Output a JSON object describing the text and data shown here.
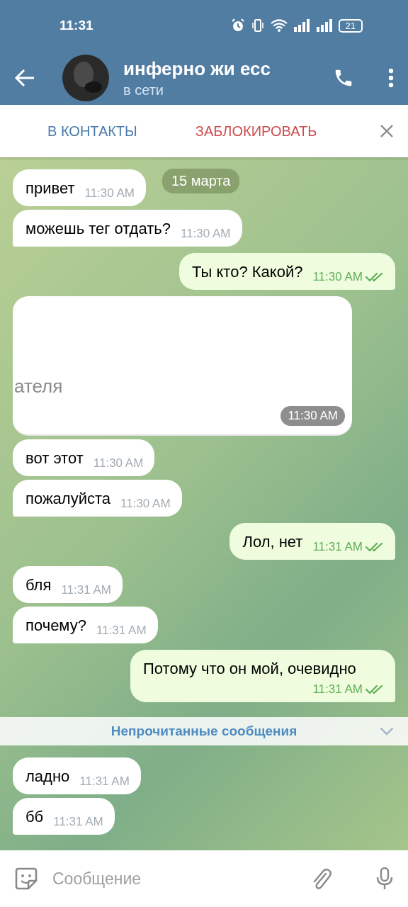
{
  "status_bar": {
    "time": "11:31",
    "battery": "21"
  },
  "header": {
    "title": "инферно жи есс",
    "status": "в сети"
  },
  "action_bar": {
    "add_contact": "В КОНТАКТЫ",
    "block": "ЗАБЛОКИРОВАТЬ"
  },
  "date_chip": "15 марта",
  "messages": [
    {
      "kind": "incoming",
      "text": "привет",
      "time": "11:30 AM",
      "tail": false
    },
    {
      "kind": "incoming",
      "text": "можешь тег отдать?",
      "time": "11:30 AM",
      "tail": true
    },
    {
      "kind": "outgoing",
      "text": "Ты кто? Какой?",
      "time": "11:30 AM",
      "read": true,
      "tail": true
    },
    {
      "kind": "media",
      "text": "ателя",
      "time": "11:30 AM"
    },
    {
      "kind": "incoming",
      "text": "вот этот",
      "time": "11:30 AM",
      "tail": false
    },
    {
      "kind": "incoming",
      "text": "пожалуйста",
      "time": "11:30 AM",
      "tail": true
    },
    {
      "kind": "outgoing",
      "text": "Лол, нет",
      "time": "11:31 AM",
      "read": true,
      "tail": true
    },
    {
      "kind": "incoming",
      "text": "бля",
      "time": "11:31 AM",
      "tail": false
    },
    {
      "kind": "incoming",
      "text": "почему?",
      "time": "11:31 AM",
      "tail": true
    },
    {
      "kind": "outgoing",
      "text": "Потому что он мой, очевидно",
      "time": "11:31 AM",
      "read": true,
      "tail": true
    },
    {
      "kind": "divider",
      "text": "Непрочитанные сообщения"
    },
    {
      "kind": "incoming",
      "text": "ладно",
      "time": "11:31 AM",
      "tail": false
    },
    {
      "kind": "incoming",
      "text": "бб",
      "time": "11:31 AM",
      "tail": true
    }
  ],
  "composer": {
    "placeholder": "Сообщение"
  }
}
